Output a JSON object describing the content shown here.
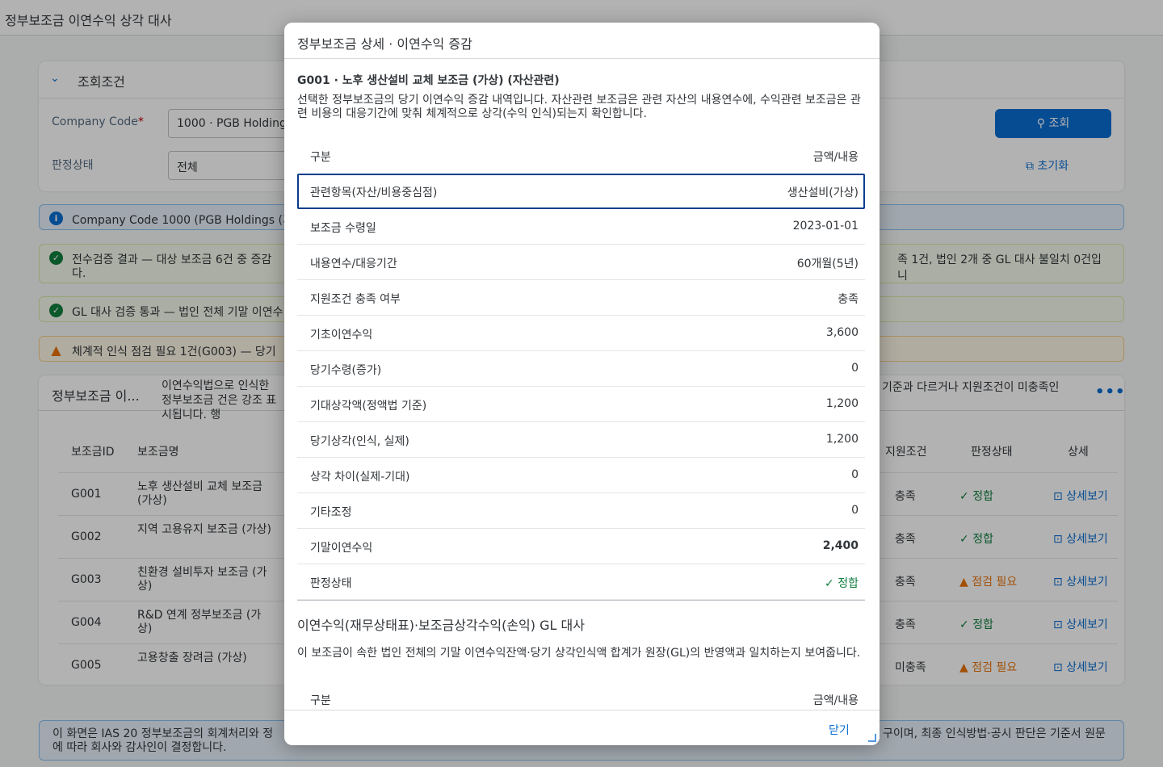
{
  "app": {
    "title": "정부보조금 이연수익 상각 대사"
  },
  "filter": {
    "header": "조회조건",
    "company_label": "Company Code",
    "company_value": "1000 · PGB Holdings",
    "status_label": "판정상태",
    "status_value": "전체",
    "search_label": "조회",
    "reset_label": "초기화"
  },
  "messages": {
    "info": "Company Code 1000 (PGB Holdings (가상",
    "ok1_left": "전수검증 결과 — 대상 보조금 6건 중 증감",
    "ok1_left2": "다.",
    "ok1_right": "족 1건, 법인 2개 중 GL 대사 불일치 0건입니",
    "ok2": "GL 대사 검증 통과 — 법인 전체 기말 이연수",
    "warn": "체계적 인식 점검 필요 1건(G003) — 당기 "
  },
  "table": {
    "title": "정부보조금 이...",
    "desc_left": "이연수익법으로 인식한 정부보조금 건은 강조 표시됩니다. 행",
    "desc_right": "기준과 다르거나 지원조건이 미충족인",
    "more": "•••",
    "headers": {
      "id": "보조금ID",
      "name": "보조금명",
      "cond": "지원조건",
      "stat": "판정상태",
      "det": "상세"
    },
    "rows": [
      {
        "id": "G001",
        "name": "노후 생산설비 교체 보조금 (가상)",
        "cond": "충족",
        "stat": "정합",
        "warn": false,
        "det": "상세보기"
      },
      {
        "id": "G002",
        "name": "지역 고용유지 보조금 (가상)",
        "cond": "충족",
        "stat": "정합",
        "warn": false,
        "det": "상세보기"
      },
      {
        "id": "G003",
        "name": "친환경 설비투자 보조금 (가상)",
        "cond": "충족",
        "stat": "점검 필요",
        "warn": true,
        "det": "상세보기"
      },
      {
        "id": "G004",
        "name": "R&D 연계 정부보조금 (가상)",
        "cond": "충족",
        "stat": "정합",
        "warn": false,
        "det": "상세보기"
      },
      {
        "id": "G005",
        "name": "고용창출 장려금 (가상)",
        "cond": "미충족",
        "stat": "점검 필요",
        "warn": true,
        "det": "상세보기"
      }
    ]
  },
  "footnote": {
    "left": "이 화면은 IAS 20 정부보조금의 회계처리와 정",
    "left2": "에 따라 회사와 감사인이 결정합니다.",
    "right": "구이며, 최종 인식방법·공시 판단은 기준서 원문"
  },
  "dialog": {
    "title": "정부보조금 상세 · 이연수익 증감",
    "subtitle": "G001 · 노후 생산설비 교체 보조금 (가상) (자산관련)",
    "desc": "선택한 정부보조금의 당기 이연수익 증감 내역입니다. 자산관련 보조금은 관련 자산의 내용연수에, 수익관련 보조금은 관련 비용의 대응기간에 맞춰 체계적으로 상각(수익 인식)되는지 확인합니다.",
    "col_a": "구분",
    "col_b": "금액/내용",
    "rows": [
      {
        "a": "관련항목(자산/비용중심점)",
        "b": "생산설비(가상)"
      },
      {
        "a": "보조금 수령일",
        "b": "2023-01-01"
      },
      {
        "a": "내용연수/대응기간",
        "b": "60개월(5년)"
      },
      {
        "a": "지원조건 충족 여부",
        "b": "충족"
      },
      {
        "a": "기초이연수익",
        "b": "3,600"
      },
      {
        "a": "당기수령(증가)",
        "b": "0"
      },
      {
        "a": "기대상각액(정액법 기준)",
        "b": "1,200"
      },
      {
        "a": "당기상각(인식, 실제)",
        "b": "1,200"
      },
      {
        "a": "상각 차이(실제-기대)",
        "b": "0"
      },
      {
        "a": "기타조정",
        "b": "0"
      },
      {
        "a": "기말이연수익",
        "b": "2,400"
      },
      {
        "a": "판정상태",
        "b": "정합"
      }
    ],
    "sec2_title": "이연수익(재무상태표)·보조금상각수익(손익) GL 대사",
    "sec2_desc": "이 보조금이 속한 법인 전체의 기말 이연수익잔액·당기 상각인식액 합계가 원장(GL)의 반영액과 일치하는지 보여줍니다.",
    "sec2_col_a": "구분",
    "sec2_col_b": "금액/내용",
    "close_label": "닫기"
  },
  "colors": {
    "accent": "#0a6ed1",
    "positive": "#107e3e",
    "critical": "#e9730c"
  }
}
